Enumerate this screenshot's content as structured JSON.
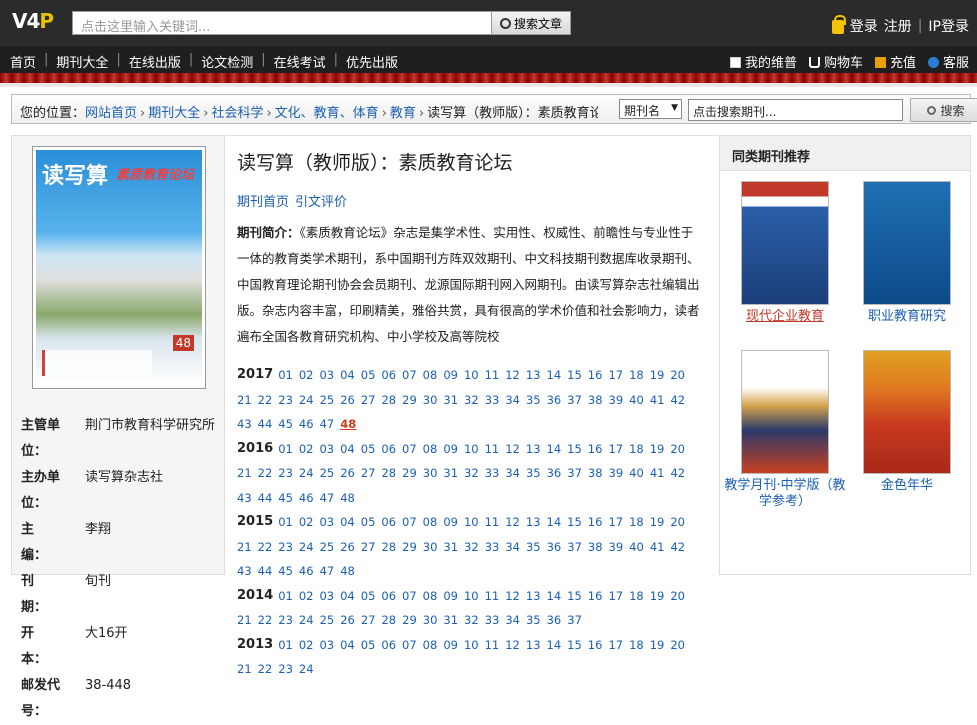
{
  "top": {
    "logo": "V4P",
    "search_placeholder": "点击这里输入关键词...",
    "search_button": "搜索文章",
    "login": "登录",
    "register": "注册",
    "ip_login": "IP登录"
  },
  "nav": {
    "items": [
      "首页",
      "期刊大全",
      "在线出版",
      "论文检测",
      "在线考试",
      "优先出版"
    ],
    "right": [
      "我的维普",
      "购物车",
      "充值",
      "客服"
    ]
  },
  "breadcrumb": {
    "prefix": "您的位置：",
    "links": [
      "网站首页",
      "期刊大全",
      "社会科学",
      "文化、教育、体育",
      "教育"
    ],
    "current": "读写算（教师版）：素质教育论坛",
    "select_value": "期刊名",
    "search_value": "点击搜索期刊...",
    "search_button": "搜索"
  },
  "cover": {
    "title": "读写算",
    "subtitle": "素质教育论坛",
    "issue": "48"
  },
  "info": [
    {
      "label": "主管单位：",
      "value": "荆门市教育科学研究所"
    },
    {
      "label": "主办单位：",
      "value": "读写算杂志社"
    },
    {
      "label": "主　　编：",
      "value": "李翔"
    },
    {
      "label": "刊　　期：",
      "value": "旬刊"
    },
    {
      "label": "开　　本：",
      "value": "大16开"
    },
    {
      "label": "邮发代号：",
      "value": "38-448"
    }
  ],
  "journal": {
    "title": "读写算（教师版）：素质教育论坛",
    "tab_home": "期刊首页",
    "tab_cite": "引文评价",
    "intro_label": "期刊简介：",
    "intro_text": "《素质教育论坛》杂志是集学术性、实用性、权威性、前瞻性与专业性于一体的教育类学术期刊，系中国期刊方阵双效期刊、中文科技期刊数据库收录期刊、中国教育理论期刊协会会员期刊、龙源国际期刊网入网期刊。由读写算杂志社编辑出版。杂志内容丰富，印刷精美，雅俗共赏，具有很高的学术价值和社会影响力，读者遍布全国各教育研究机构、中小学校及高等院校"
  },
  "years": [
    {
      "year": "2017",
      "count": 48,
      "current": "48"
    },
    {
      "year": "2016",
      "count": 48,
      "current": ""
    },
    {
      "year": "2015",
      "count": 48,
      "current": ""
    },
    {
      "year": "2014",
      "count": 37,
      "current": ""
    },
    {
      "year": "2013",
      "count": 24,
      "current": ""
    }
  ],
  "recommend": {
    "header": "同类期刊推荐",
    "items": [
      {
        "name": "现代企业教育",
        "cover_text": "现代企业教育"
      },
      {
        "name": "职业教育研究",
        "cover_text": "职业教育研究"
      },
      {
        "name": "教学月刊·中学版（教学参考）",
        "cover_text": "教学月刊"
      },
      {
        "name": "金色年华",
        "cover_text": "金色年华"
      }
    ]
  }
}
